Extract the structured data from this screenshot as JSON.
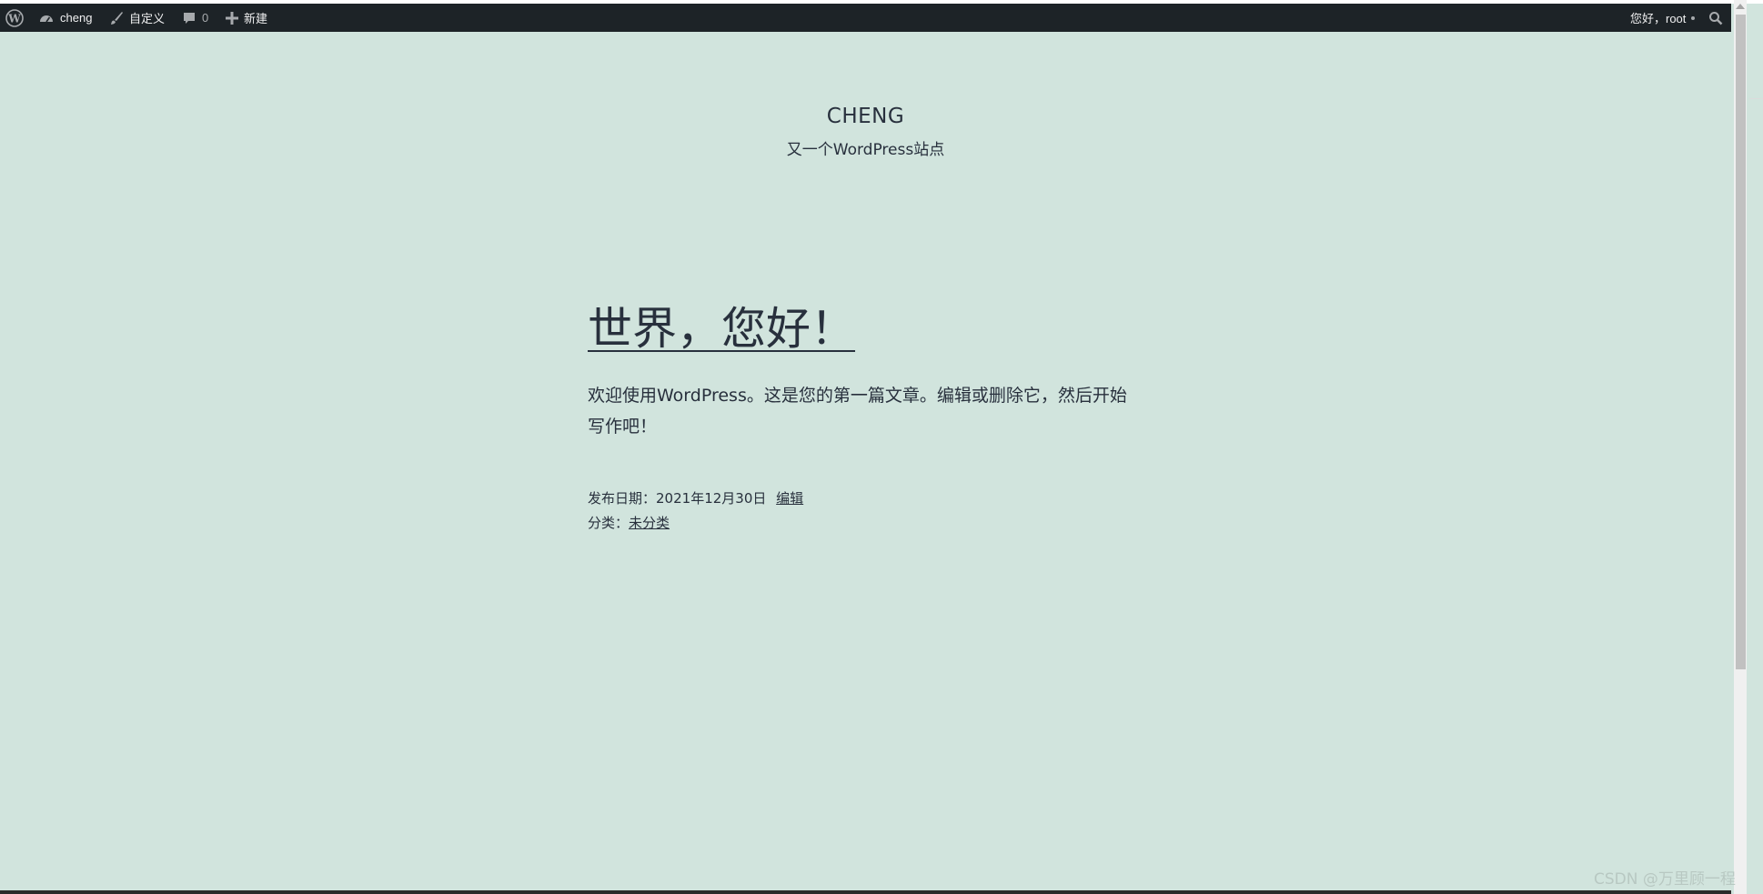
{
  "adminbar": {
    "site_name": "cheng",
    "customize_label": "自定义",
    "comments_count": "0",
    "new_label": "新建",
    "greeting": "您好，root"
  },
  "site": {
    "title": "CHENG",
    "tagline": "又一个WordPress站点"
  },
  "post": {
    "title": "世界，您好！",
    "excerpt": "欢迎使用WordPress。这是您的第一篇文章。编辑或删除它，然后开始写作吧！",
    "date_label": "发布日期：",
    "date_value": "2021年12月30日",
    "edit_label": "编辑",
    "category_label": "分类：",
    "category_value": "未分类"
  },
  "watermark": "CSDN @万里顾一程",
  "colors": {
    "page_background": "#d1e4dd",
    "adminbar_background": "#1d2327",
    "text": "#28303d"
  }
}
